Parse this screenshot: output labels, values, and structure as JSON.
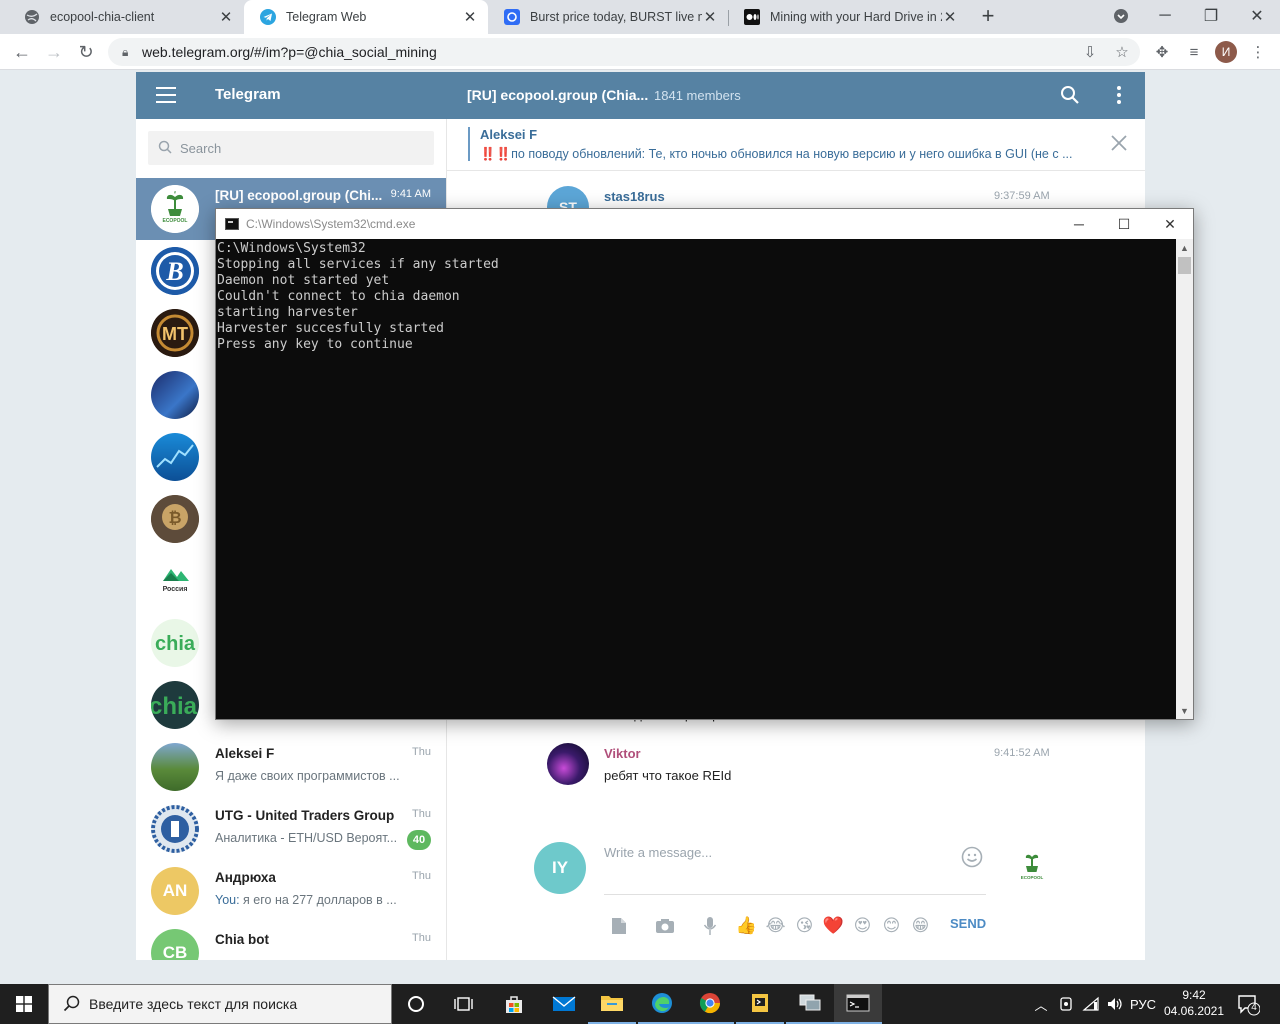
{
  "browser": {
    "tabs": [
      {
        "title": "ecopool-chia-client",
        "active": false
      },
      {
        "title": "Telegram Web",
        "active": true
      },
      {
        "title": "Burst price today, BURST live ma",
        "active": false
      },
      {
        "title": "Mining with your Hard Drive in 2",
        "active": false
      }
    ],
    "url": "web.telegram.org/#/im?p=@chia_social_mining",
    "profile_initial": "И"
  },
  "telegram": {
    "brand": "Telegram",
    "chat_title": "[RU] ecopool.group (Chia...",
    "members": "1841 members",
    "search_placeholder": "Search",
    "dialogs": [
      {
        "name": "[RU] ecopool.group (Chi...",
        "time": "9:41 AM",
        "message": "",
        "avatar": "ecopool",
        "active": true
      },
      {
        "name": "",
        "time": "",
        "message": "",
        "avatar": "burst"
      },
      {
        "name": "",
        "time": "",
        "message": "",
        "avatar": "mt"
      },
      {
        "name": "",
        "time": "",
        "message": "",
        "avatar": "city"
      },
      {
        "name": "",
        "time": "",
        "message": "",
        "avatar": "chart"
      },
      {
        "name": "",
        "time": "",
        "message": "",
        "avatar": "bitcoin"
      },
      {
        "name": "",
        "time": "",
        "message": "",
        "avatar": "russia",
        "avatar_label": "Россия"
      },
      {
        "name": "",
        "time": "",
        "message": "",
        "avatar": "chia",
        "avatar_label": "chia"
      },
      {
        "name": "",
        "time": "",
        "message": "",
        "avatar": "chia-dark",
        "avatar_label": "chia"
      },
      {
        "name": "Aleksei F",
        "time": "Thu",
        "message": "Я даже своих программистов ...",
        "avatar": "photo"
      },
      {
        "name": "UTG - United Traders Group",
        "time": "Thu",
        "message": "Аналитика - ETH/USD Вероят...",
        "avatar": "utg",
        "badge": "40"
      },
      {
        "name": "Андрюха",
        "time": "Thu",
        "message_prefix": "You:",
        "message": " я его на 277 долларов в ...",
        "avatar": "initials",
        "initials": "AN"
      },
      {
        "name": "Chia bot",
        "time": "Thu",
        "message": "",
        "avatar": "initials",
        "initials": "CB"
      }
    ],
    "pinned": {
      "author": "Aleksei F",
      "text": "‼️‼️по поводу обновлений: Те, кто ночью обновился на новую версию и у него ошибка в GUI (не с ..."
    },
    "messages": [
      {
        "author": "stas18rus",
        "time": "9:37:59 AM",
        "text": "",
        "initials": "ST",
        "author_color": "#3a6d99"
      },
      {
        "author": "",
        "time": "",
        "text": "это администраторам...............................",
        "initials": ""
      },
      {
        "author": "Viktor",
        "time": "9:41:52 AM",
        "text": "ребят что такое REId",
        "initials": "",
        "author_color": "#b04f7a"
      }
    ],
    "composer": {
      "avatar_initials": "IY",
      "placeholder": "Write a message...",
      "send_label": "SEND",
      "emojis": [
        "👍",
        "😂",
        "😘",
        "❤️",
        "😍",
        "😊",
        "😁"
      ]
    }
  },
  "cmd": {
    "title": "C:\\Windows\\System32\\cmd.exe",
    "output": "C:\\Windows\\System32\nStopping all services if any started\nDaemon not started yet\nCouldn't connect to chia daemon\nstarting harvester\nHarvester succesfully started\nPress any key to continue"
  },
  "taskbar": {
    "search_placeholder": "Введите здесь текст для поиска",
    "language": "РУС",
    "time": "9:42",
    "date": "04.06.2021",
    "notification_count": "4"
  },
  "colors": {
    "tg_header": "#5682a3",
    "tg_active_dialog": "#6b8fb3",
    "badge": "#5eb85f",
    "cmd_bg": "#0c0c0c",
    "taskbar": "#1f1f1f"
  }
}
